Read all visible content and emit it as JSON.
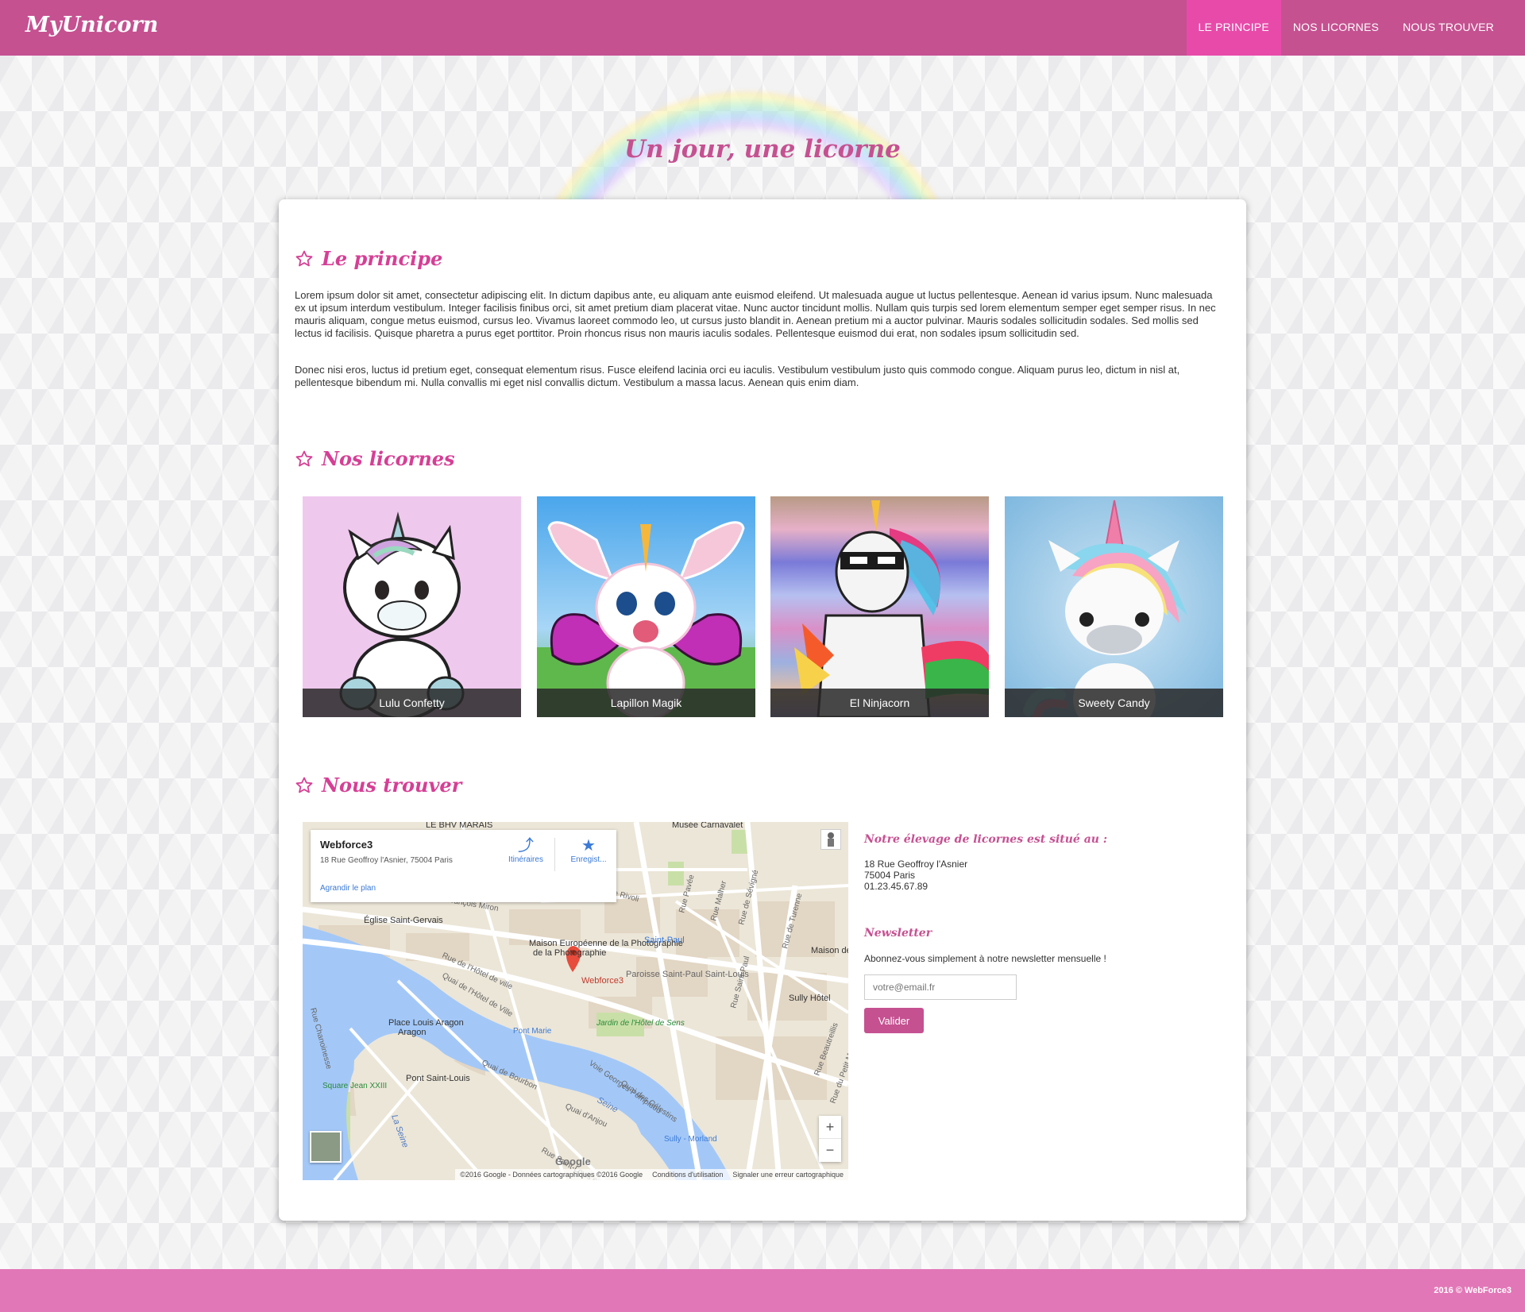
{
  "brand": "MyUnicorn",
  "nav": {
    "items": [
      "LE PRINCIPE",
      "NOS LICORNES",
      "NOUS TROUVER"
    ],
    "active": "LE PRINCIPE"
  },
  "hero": {
    "title": "Un jour, une licorne"
  },
  "principe": {
    "title": "Le principe",
    "paragraphs": [
      "Lorem ipsum dolor sit amet, consectetur adipiscing elit. In dictum dapibus ante, eu aliquam ante euismod eleifend. Ut malesuada augue ut luctus pellentesque. Aenean id varius ipsum. Nunc malesuada ex ut ipsum interdum vestibulum. Integer facilisis finibus orci, sit amet pretium diam placerat vitae. Nunc auctor tincidunt mollis. Nullam quis turpis sed lorem elementum semper eget semper risus. In nec mauris aliquam, congue metus euismod, cursus leo. Vivamus laoreet commodo leo, ut cursus justo blandit in. Aenean pretium mi a auctor pulvinar. Mauris sodales sollicitudin sodales. Sed mollis sed lectus id facilisis. Quisque pharetra a purus eget porttitor. Proin rhoncus risus non mauris iaculis sodales. Pellentesque euismod dui erat, non sodales ipsum sollicitudin sed.",
      "Donec nisi eros, luctus id pretium eget, consequat elementum risus. Fusce eleifend lacinia orci eu iaculis. Vestibulum vestibulum justo quis commodo congue. Aliquam purus leo, dictum in nisl at, pellentesque bibendum mi. Nulla convallis mi eget nisl convallis dictum. Vestibulum a massa lacus. Aenean quis enim diam."
    ]
  },
  "licornes": {
    "title": "Nos licornes",
    "items": [
      {
        "name": "Lulu Confetty",
        "bg": "#efc8ee"
      },
      {
        "name": "Lapillon Magik",
        "bg": "#69b7ee"
      },
      {
        "name": "El Ninjacorn",
        "bg": "#8a8fd0"
      },
      {
        "name": "Sweety Candy",
        "bg": "#8fc3e7"
      }
    ]
  },
  "trouver": {
    "title": "Nous trouver",
    "map": {
      "place": "Webforce3",
      "address": "18 Rue Geoffroy l'Asnier, 75004 Paris",
      "directions_label": "Itinéraires",
      "save_label": "Enregist...",
      "enlarge_label": "Agrandir le plan",
      "marker_label": "Webforce3",
      "labels": [
        "LE BHV MARAIS",
        "Musée Carnavalet",
        "Église Saint-Gervais",
        "Rue François Miron",
        "Maison Européenne de la Photographie",
        "Saint-Paul",
        "Paroisse Saint-Paul Saint-Louis",
        "Sully Hôtel",
        "Place Louis Aragon",
        "Pont Marie",
        "Jardin de l'Hôtel de Sens",
        "Pont Saint-Louis",
        "Square Jean XXIII",
        "La Seine",
        "Seine",
        "Sully - Morland",
        "Quai de Bourbon",
        "Quai d'Anjou",
        "Quai des Célestins",
        "Voie Georges Pompidou",
        "Rue de Rivoli",
        "Rue Saint-Paul",
        "Rue de Turenne",
        "Rue de Sévigné",
        "Rue Pavée",
        "Rue Malher",
        "Quai de l'Hôtel de Ville",
        "Rue de l'Hôtel de ville",
        "Rue Chanoinesse",
        "Rue Saint-Louis en l'Île",
        "Rue Beautreillis",
        "Rue du Petit Musc",
        "Maison de"
      ],
      "attribution": "©2016 Google - Données cartographiques ©2016 Google",
      "terms": "Conditions d'utilisation",
      "report": "Signaler une erreur cartographique",
      "google": "Google",
      "zoom_in": "+",
      "zoom_out": "−"
    },
    "contact": {
      "heading": "Notre élevage de licornes est situé au :",
      "street": "18 Rue Geoffroy l'Asnier",
      "city": "75004 Paris",
      "phone": "01.23.45.67.89"
    },
    "newsletter": {
      "heading": "Newsletter",
      "text": "Abonnez-vous simplement à notre newsletter mensuelle !",
      "placeholder": "votre@email.fr",
      "button": "Valider"
    }
  },
  "footer": {
    "text": "2016 © WebForce3"
  },
  "colors": {
    "primary": "#c55191",
    "nav_active": "#e84aaa",
    "accent": "#d63f95",
    "footer": "#e277b7"
  }
}
